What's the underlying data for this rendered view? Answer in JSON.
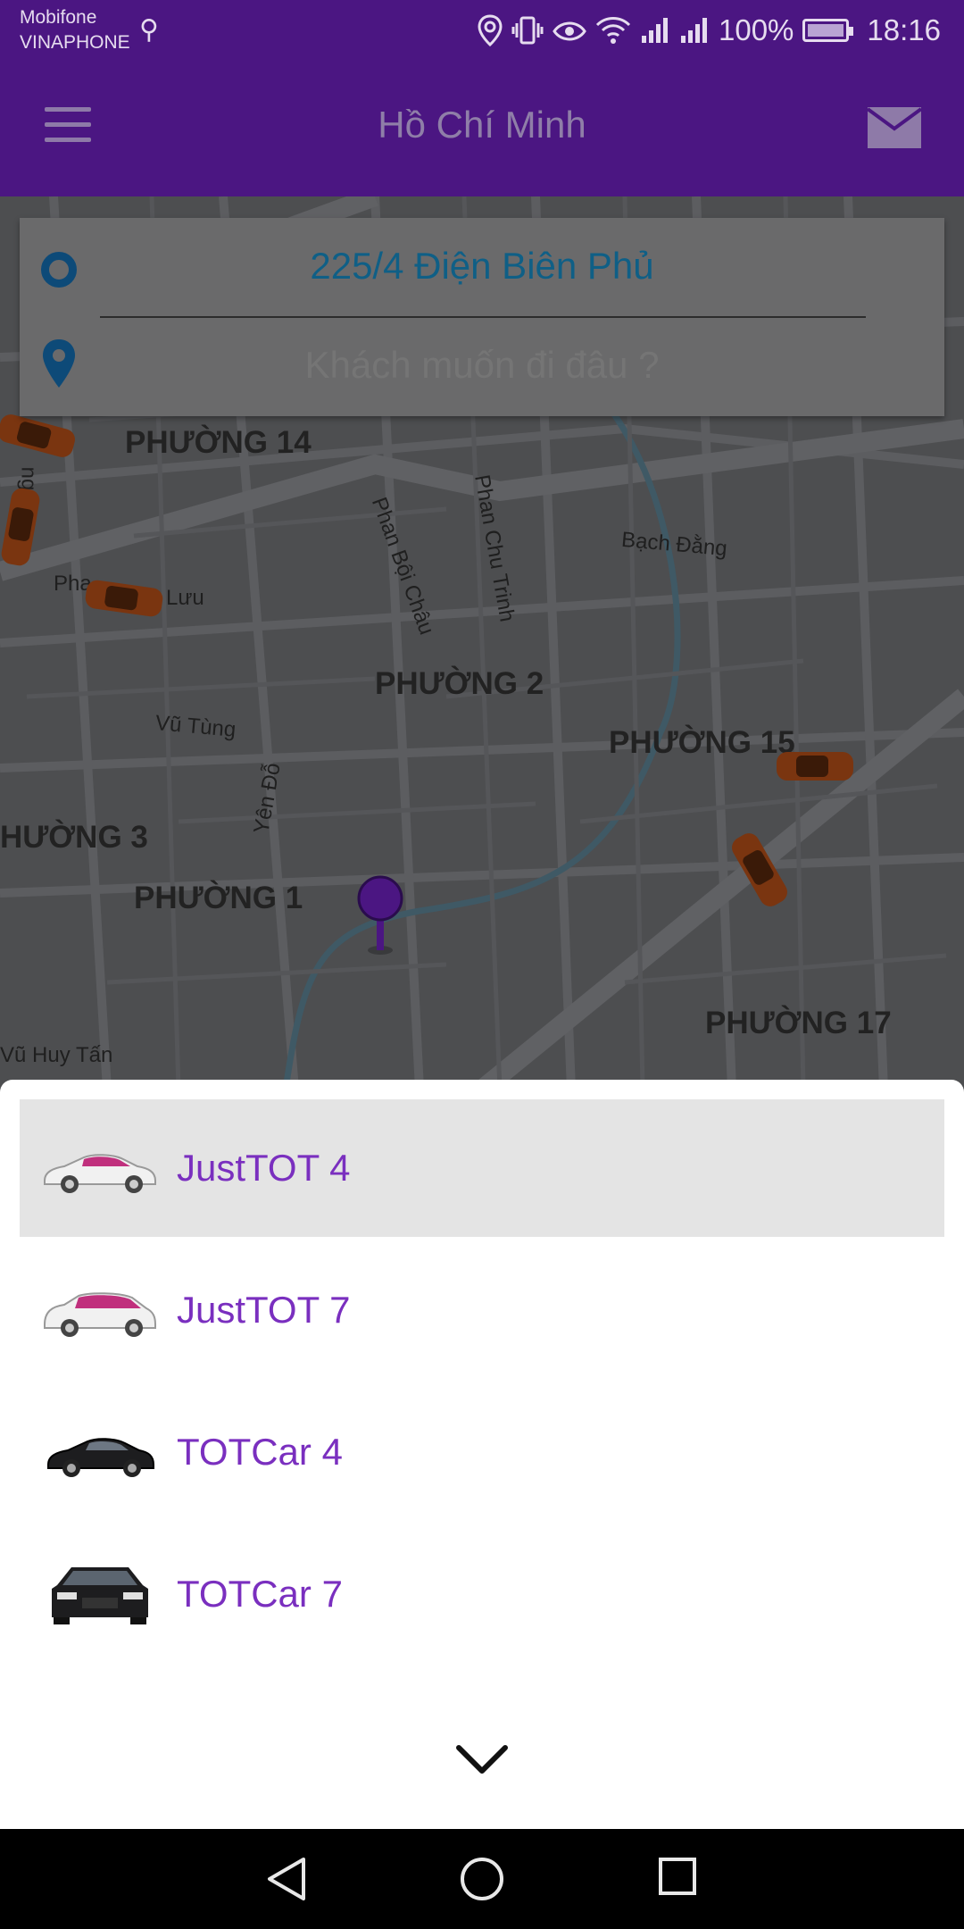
{
  "status_bar": {
    "carrier_1": "Mobifone",
    "carrier_2": "VINAPHONE",
    "battery": "100%",
    "time": "18:16"
  },
  "toolbar": {
    "title": "Hồ Chí Minh"
  },
  "address": {
    "pickup": "225/4 Điện Biên Phủ",
    "destination_placeholder": "Khách muốn đi đâu ?"
  },
  "map": {
    "districts": [
      "PHƯỜNG 14",
      "PHƯỜNG 2",
      "PHƯỜNG 15",
      "HƯỜNG 3",
      "PHƯỜNG 1",
      "PHƯỜNG 17"
    ],
    "streets": [
      "Phan Bội Châu",
      "Phan Chu Trinh",
      "Bạch Đằng",
      "Pha",
      "Lưu",
      "Vũ Tùng",
      "Yên Đỗ",
      "Vũ Huy Tấn",
      "ng"
    ]
  },
  "vehicles": [
    {
      "label": "JustTOT 4",
      "selected": true
    },
    {
      "label": "JustTOT 7",
      "selected": false
    },
    {
      "label": "TOTCar 4",
      "selected": false
    },
    {
      "label": "TOTCar 7",
      "selected": false
    }
  ],
  "colors": {
    "brand": "#4b1682",
    "accent": "#7a2fbf",
    "pickup": "#0f5f86"
  }
}
